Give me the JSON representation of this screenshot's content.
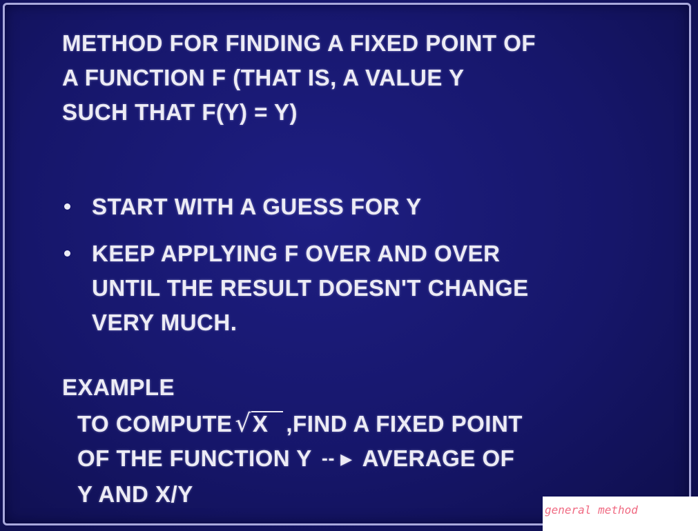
{
  "slide": {
    "heading_lines": [
      "METHOD FOR FINDING A FIXED POINT OF",
      "A FUNCTION F (THAT IS, A VALUE Y",
      "SUCH THAT F(Y) = Y)"
    ],
    "bullets": [
      {
        "lines": [
          "START WITH A GUESS FOR Y"
        ]
      },
      {
        "lines": [
          "KEEP APPLYING F OVER AND OVER",
          "UNTIL THE RESULT DOESN'T CHANGE",
          "VERY MUCH."
        ]
      }
    ],
    "example_label": "EXAMPLE",
    "example_lines": {
      "l1_before": "TO COMPUTE",
      "sqrt_arg": "X",
      "l1_after": ",FIND A FIXED POINT",
      "l2_before": "OF THE FUNCTION Y",
      "arrow": "-- ▶",
      "l2_after": "AVERAGE OF",
      "l3": "Y AND X/Y"
    }
  },
  "annotation": {
    "text": "general method",
    "color": "#f06a82"
  },
  "colors": {
    "background": "#16166a",
    "text": "#ecebf5",
    "frame": "#a9a9dc"
  }
}
